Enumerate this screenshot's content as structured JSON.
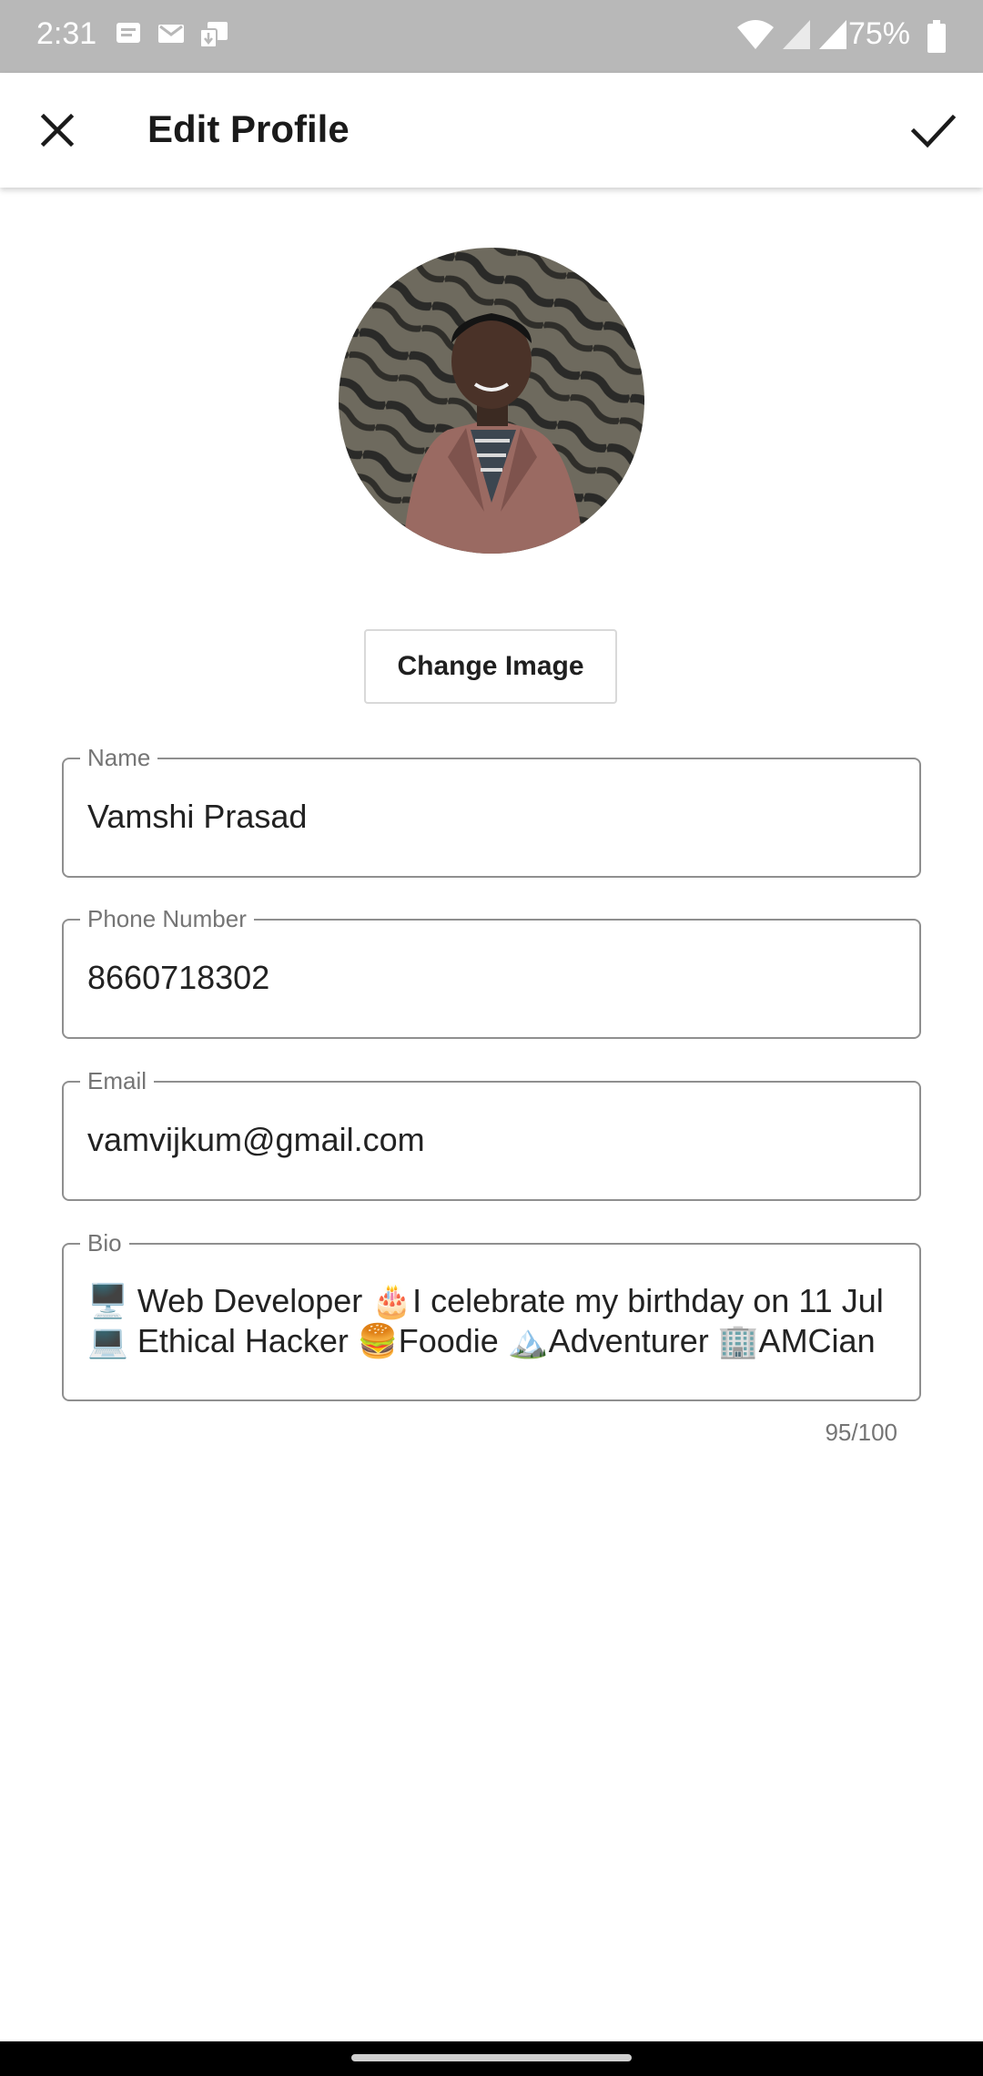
{
  "status_bar": {
    "time": "2:31",
    "battery_percent": "75%",
    "icons": [
      "messages-icon",
      "gmail-icon",
      "download-icon",
      "wifi-icon",
      "signal-icon",
      "signal-icon",
      "battery-icon"
    ]
  },
  "app_bar": {
    "title": "Edit Profile",
    "close_icon": "close-icon",
    "confirm_icon": "check-icon"
  },
  "profile": {
    "change_image_label": "Change Image"
  },
  "form": {
    "name": {
      "label": "Name",
      "value": "Vamshi Prasad"
    },
    "phone": {
      "label": "Phone Number",
      "value": "8660718302"
    },
    "email": {
      "label": "Email",
      "value": "vamvijkum@gmail.com"
    },
    "bio": {
      "label": "Bio",
      "line1": "🖥️ Web Developer 🎂I celebrate my birthday on 11 Jul",
      "line2": "💻 Ethical Hacker 🍔Foodie 🏔️Adventurer 🏢AMCian",
      "counter": "95/100"
    }
  },
  "colors": {
    "status_bar": "#b8b8b8",
    "app_bar": "#ffffff",
    "field_border": "#8f8f8f",
    "label_gray": "#757575",
    "nav_bar": "#000000"
  }
}
